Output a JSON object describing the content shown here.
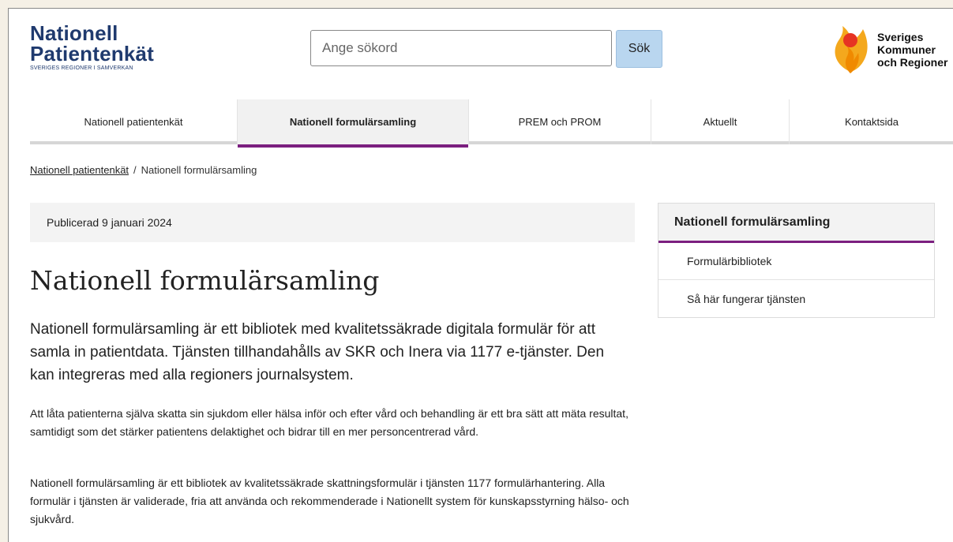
{
  "header": {
    "logo_line1": "Nationell",
    "logo_line2": "Patientenkät",
    "logo_sub": "SVERIGES REGIONER I SAMVERKAN",
    "search_placeholder": "Ange sökord",
    "search_button": "Sök",
    "skr_line1": "Sveriges",
    "skr_line2": "Kommuner",
    "skr_line3": "och Regioner"
  },
  "nav": {
    "items": [
      {
        "label": "Nationell patientenkät"
      },
      {
        "label": "Nationell formulärsamling"
      },
      {
        "label": "PREM och PROM"
      },
      {
        "label": "Aktuellt"
      },
      {
        "label": "Kontaktsida"
      }
    ]
  },
  "breadcrumb": {
    "home": "Nationell patientenkät",
    "separator": "/",
    "current": "Nationell formulärsamling"
  },
  "main": {
    "published": "Publicerad 9 januari 2024",
    "title": "Nationell formulärsamling",
    "lead": "Nationell formulärsamling är ett bibliotek med kvalitetssäkrade digitala formulär för att samla in patientdata. Tjänsten tillhandahålls av SKR och Inera via 1177 e-tjänster. Den kan integreras med alla regioners journalsystem.",
    "paragraph1": "Att låta patienterna själva skatta sin sjukdom eller hälsa inför och efter vård och behandling är ett bra sätt att mäta resultat, samtidigt som det stärker patientens delaktighet och bidrar till en mer personcentrerad vård.",
    "paragraph2": "Nationell formulärsamling är ett bibliotek av kvalitetssäkrade skattningsformulär i tjänsten 1177 formulärhantering. Alla formulär i tjänsten är validerade, fria att använda och rekommenderade i Nationellt system för kunskapsstyrning hälso- och sjukvård."
  },
  "sidebar": {
    "title": "Nationell formulärsamling",
    "links": [
      {
        "label": "Formulärbibliotek"
      },
      {
        "label": "Så här fungerar tjänsten"
      }
    ]
  },
  "colors": {
    "brand_blue": "#1f3a6e",
    "accent_purple": "#7b1f7f",
    "search_button_bg": "#b9d6ef"
  }
}
